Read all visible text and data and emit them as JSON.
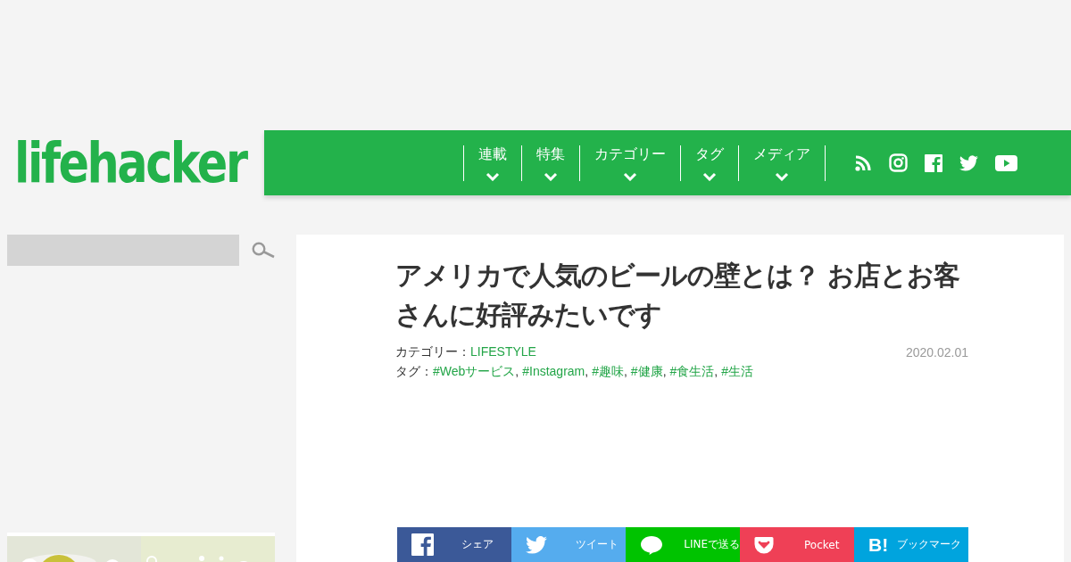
{
  "logo": "lifehacker",
  "nav": [
    {
      "label": "連載"
    },
    {
      "label": "特集"
    },
    {
      "label": "カテゴリー"
    },
    {
      "label": "タグ"
    },
    {
      "label": "メディア"
    }
  ],
  "social": [
    {
      "kind": "rss"
    },
    {
      "kind": "instagram"
    },
    {
      "kind": "facebook"
    },
    {
      "kind": "twitter"
    },
    {
      "kind": "youtube"
    }
  ],
  "article": {
    "title": "アメリカで人気のビールの壁とは？ お店とお客さんに好評みたいです",
    "category_label": "カテゴリー：",
    "category": "LIFESTYLE",
    "date": "2020.02.01",
    "tags_label": "タグ：",
    "tag_separator": ",",
    "tags": [
      "#Webサービス",
      "#Instagram",
      "#趣味",
      "#健康",
      "#食生活",
      "#生活"
    ],
    "share": [
      {
        "kind": "facebook",
        "label": "シェア",
        "color": "#3b5998"
      },
      {
        "kind": "twitter",
        "label": "ツイート",
        "color": "#55acee"
      },
      {
        "kind": "line",
        "label": "LINEで送る",
        "color": "#00c300"
      },
      {
        "kind": "pocket",
        "label": "Pocket",
        "color": "#ef4056"
      },
      {
        "kind": "hatena",
        "label": "ブックマーク",
        "color": "#00a4de",
        "icon_text": "B!"
      }
    ]
  }
}
